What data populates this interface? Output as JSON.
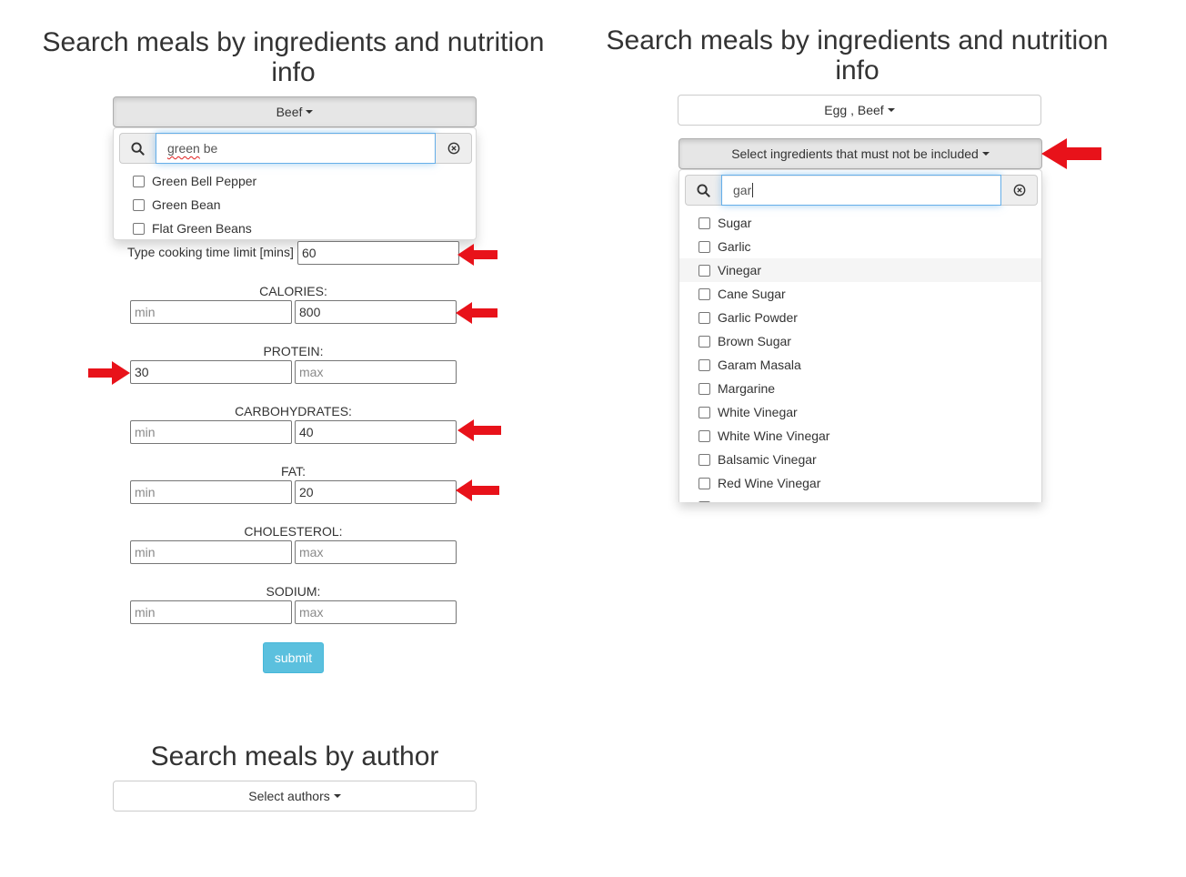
{
  "left": {
    "title": "Search meals by ingredients and nutrition info",
    "ingredients_button": "Beef",
    "dropdown": {
      "search_value_underlined": "green",
      "search_value_rest": " be",
      "search_icon": "search-icon",
      "clear_icon": "clear-circle-icon",
      "options": [
        "Green Bell Pepper",
        "Green Bean",
        "Flat Green Beans"
      ]
    },
    "cooking_time": {
      "label": "Type cooking time limit [mins]",
      "value": "60"
    },
    "nutrition": [
      {
        "label": "CALORIES:",
        "min": "",
        "max": "800"
      },
      {
        "label": "PROTEIN:",
        "min": "30",
        "max": ""
      },
      {
        "label": "CARBOHYDRATES:",
        "min": "",
        "max": "40"
      },
      {
        "label": "FAT:",
        "min": "",
        "max": "20"
      },
      {
        "label": "CHOLESTEROL:",
        "min": "",
        "max": ""
      },
      {
        "label": "SODIUM:",
        "min": "",
        "max": ""
      }
    ],
    "placeholders": {
      "min": "min",
      "max": "max"
    },
    "submit_label": "submit"
  },
  "author": {
    "title": "Search meals by author",
    "button": "Select authors"
  },
  "right": {
    "title": "Search meals by ingredients and nutrition info",
    "ingredients_button": "Egg , Beef",
    "exclude_button": "Select ingredients that must not be included",
    "dropdown": {
      "search_value": "gar",
      "options": [
        "Sugar",
        "Garlic",
        "Vinegar",
        "Cane Sugar",
        "Garlic Powder",
        "Brown Sugar",
        "Garam Masala",
        "Margarine",
        "White Vinegar",
        "White Wine Vinegar",
        "Balsamic Vinegar",
        "Red Wine Vinegar"
      ],
      "highlighted": "Vinegar"
    }
  },
  "colors": {
    "arrow": "#e8121a",
    "submit": "#5bc0de",
    "focus": "#66afe9"
  },
  "icons": {
    "annotation": "red-arrow-icon"
  }
}
